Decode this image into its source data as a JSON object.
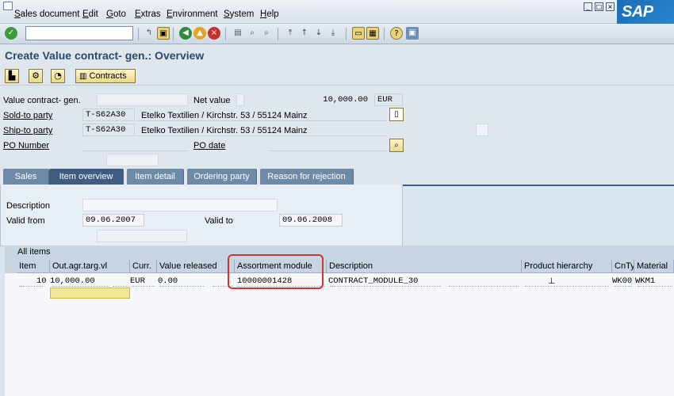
{
  "menu": {
    "items": [
      "Sales document",
      "Edit",
      "Goto",
      "Extras",
      "Environment",
      "System",
      "Help"
    ]
  },
  "branding": {
    "logo_text": "SAP"
  },
  "window_buttons": [
    "_",
    "□",
    "×"
  ],
  "title": "Create Value contract- gen.: Overview",
  "app_toolbar": {
    "contracts_label": "Contracts"
  },
  "header": {
    "value_contract_label": "Value contract- gen.",
    "net_value_label": "Net value",
    "net_value": "10,000.00",
    "currency": "EUR",
    "sold_to_label": "Sold-to party",
    "sold_to_value": "T-S62A30",
    "sold_to_name": "Etelko Textilien / Kirchstr. 53 / 55124 Mainz",
    "ship_to_label": "Ship-to party",
    "ship_to_value": "T-S62A30",
    "ship_to_name": "Etelko Textilien / Kirchstr. 53 / 55124 Mainz",
    "po_number_label": "PO Number",
    "po_date_label": "PO date"
  },
  "tabs": [
    {
      "label": "Sales",
      "active": false
    },
    {
      "label": "Item overview",
      "active": true
    },
    {
      "label": "Item detail",
      "active": false
    },
    {
      "label": "Ordering party",
      "active": false
    },
    {
      "label": "Reason for rejection",
      "active": false
    }
  ],
  "item_overview": {
    "description_label": "Description",
    "valid_from_label": "Valid from",
    "valid_from": "09.06.2007",
    "valid_to_label": "Valid to",
    "valid_to": "09.06.2008"
  },
  "table": {
    "title": "All items",
    "columns": [
      "Item",
      "Out.agr.targ.vl",
      "Curr.",
      "Value released",
      "Assortment module",
      "Description",
      "Product hierarchy",
      "CnTy",
      "Material"
    ],
    "rows": [
      {
        "item": "10",
        "target": "10,000.00",
        "curr": "EUR",
        "released": "0.00",
        "module": "10000001428",
        "description": "CONTRACT_MODULE_30",
        "hierarchy": "",
        "cnty": "WK00",
        "material": "WKM1"
      }
    ]
  },
  "colors": {
    "tab_active": "#3e5d80",
    "tab_inactive": "#6f8aa6",
    "highlight": "#d9322f",
    "selected_cell": "#f2e894"
  }
}
